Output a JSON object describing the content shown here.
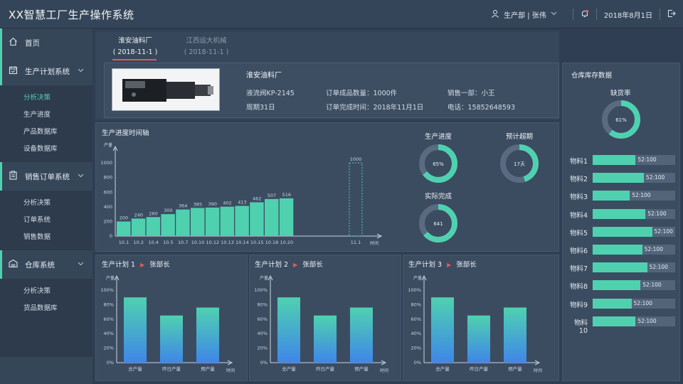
{
  "app": {
    "title": "XX智慧工厂生产操作系统"
  },
  "header": {
    "user_text": "生产部 | 张伟",
    "date": "2018年8月1日"
  },
  "colors": {
    "accent": "#4fd1b0",
    "bar_gradient_top": "#4fd1b0",
    "bar_gradient_bottom": "#3f86e8",
    "tab_underline": "#e05a5a",
    "arrow": "#e05a5a"
  },
  "sidebar": {
    "sections": [
      {
        "label": "首页",
        "icon": "home-icon",
        "items": []
      },
      {
        "label": "生产计划系统",
        "icon": "calendar-icon",
        "items": [
          "分析决策",
          "生产进度",
          "产品数据库",
          "设备数据库"
        ]
      },
      {
        "label": "销售订单系统",
        "icon": "clipboard-icon",
        "items": [
          "分析决策",
          "订单系统",
          "销售数据"
        ]
      },
      {
        "label": "仓库系统",
        "icon": "warehouse-icon",
        "items": [
          "分析决策",
          "货品数据库"
        ]
      }
    ]
  },
  "tabs": [
    {
      "name": "淮安油料厂",
      "date": "( 2018-11-1 )"
    },
    {
      "name": "江西运大机械",
      "date": "( 2018-11-1 )"
    }
  ],
  "order": {
    "company": "淮安油料厂",
    "product": "液流阀KP-2145",
    "order_qty": "订单成品数量：1000件",
    "sales": "销售一部：小王",
    "cycle": "周期31日",
    "finish_time": "订单完成时间：2018年11月1日",
    "phone": "电话：15852648593"
  },
  "timeline": {
    "title": "生产进度时间轴",
    "ylabel": "产量",
    "xlabel": "时间"
  },
  "donuts": {
    "progress": {
      "title": "生产进度",
      "label": "65%",
      "value": 65
    },
    "overdue": {
      "title": "预计超期",
      "label": "17天",
      "value": 45
    },
    "actual": {
      "title": "实际完成",
      "label": "641",
      "value": 64
    }
  },
  "plans": [
    {
      "title": "生产计划 1",
      "owner": "张部长"
    },
    {
      "title": "生产计划 2",
      "owner": "张部长"
    },
    {
      "title": "生产计划 3",
      "owner": "张部长"
    }
  ],
  "warehouse": {
    "title": "仓库库存数据",
    "shortage_title": "缺货率",
    "shortage_label": "61%",
    "shortage_value": 61,
    "materials": [
      {
        "name": "物料1",
        "value_label": "52:100",
        "fill": 0.52
      },
      {
        "name": "物料2",
        "value_label": "52:100",
        "fill": 0.62
      },
      {
        "name": "物料3",
        "value_label": "52:100",
        "fill": 0.45
      },
      {
        "name": "物料4",
        "value_label": "52:100",
        "fill": 0.64
      },
      {
        "name": "物料5",
        "value_label": "52:100",
        "fill": 0.72
      },
      {
        "name": "物料6",
        "value_label": "52:100",
        "fill": 0.6
      },
      {
        "name": "物料7",
        "value_label": "52:100",
        "fill": 0.66
      },
      {
        "name": "物料8",
        "value_label": "52:100",
        "fill": 0.58
      },
      {
        "name": "物料9",
        "value_label": "52:100",
        "fill": 0.47
      },
      {
        "name": "物料10",
        "value_label": "52:100",
        "fill": 0.52
      }
    ]
  },
  "chart_data": [
    {
      "type": "bar",
      "title": "生产进度时间轴",
      "ylabel": "产量",
      "xlabel": "时间",
      "categories": [
        "10.1",
        "10.2",
        "10.4",
        "10.5",
        "10.7",
        "10.10",
        "10.12",
        "10.13",
        "10.14",
        "10.15",
        "10.18",
        "10.20",
        "11.1"
      ],
      "values": [
        200,
        240,
        260,
        300,
        364,
        385,
        390,
        402,
        413,
        462,
        507,
        516,
        1000
      ],
      "yticks": [
        0,
        200,
        400,
        600,
        800,
        1000
      ],
      "ylim": [
        0,
        1050
      ],
      "target_category": "11.1"
    },
    {
      "type": "bar",
      "title": "生产计划 1",
      "ylabel": "产量",
      "xlabel": "时间",
      "categories": [
        "总产量",
        "昨日产量",
        "预产量"
      ],
      "values": [
        90,
        65,
        76
      ],
      "yticks": [
        "0%",
        "20%",
        "40%",
        "60%",
        "80%",
        "100%"
      ],
      "ylim": [
        0,
        100
      ]
    },
    {
      "type": "bar",
      "title": "生产计划 2",
      "ylabel": "产量",
      "xlabel": "时间",
      "categories": [
        "总产量",
        "昨日产量",
        "预产量"
      ],
      "values": [
        90,
        65,
        76
      ],
      "yticks": [
        "0%",
        "20%",
        "40%",
        "60%",
        "80%",
        "100%"
      ],
      "ylim": [
        0,
        100
      ]
    },
    {
      "type": "bar",
      "title": "生产计划 3",
      "ylabel": "产量",
      "xlabel": "时间",
      "categories": [
        "总产量",
        "昨日产量",
        "预产量"
      ],
      "values": [
        90,
        65,
        76
      ],
      "yticks": [
        "0%",
        "20%",
        "40%",
        "60%",
        "80%",
        "100%"
      ],
      "ylim": [
        0,
        100
      ]
    }
  ]
}
